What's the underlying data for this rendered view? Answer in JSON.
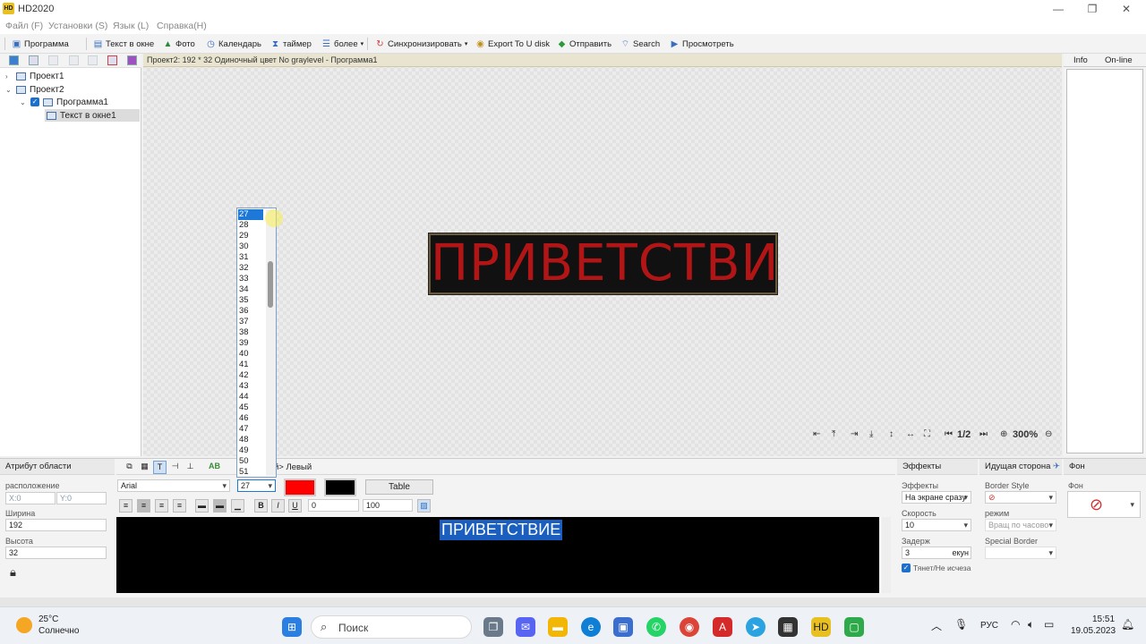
{
  "window": {
    "title": "HD2020",
    "logo": "HD"
  },
  "menu": [
    "Файл (F)",
    "Установки (S)",
    "Язык (L)",
    "Справка(H)"
  ],
  "toolbar": {
    "program": "Программа",
    "text_window": "Текст в окне",
    "photo": "Фото",
    "calendar": "Календарь",
    "timer": "таймер",
    "more": "более",
    "sync": "Синхронизировать",
    "export": "Export To U disk",
    "send": "Отправить",
    "search": "Search",
    "preview": "Просмотреть"
  },
  "tree": {
    "project1": "Проект1",
    "project2": "Проект2",
    "program1": "Программа1",
    "text1": "Текст в окне1"
  },
  "canvas": {
    "info": "Проект2: 192 * 32 Одиночный цвет No graylevel - Программа1",
    "led_text": "ПРИВЕТСТВИ",
    "page": "1/2",
    "zoom": "300%"
  },
  "right": {
    "tab_info": "Info",
    "tab_online": "On-line"
  },
  "dropdown": {
    "items": [
      "27",
      "28",
      "29",
      "30",
      "31",
      "32",
      "33",
      "34",
      "35",
      "36",
      "37",
      "38",
      "39",
      "40",
      "41",
      "42",
      "43",
      "44",
      "45",
      "46",
      "47",
      "48",
      "49",
      "50",
      "51"
    ],
    "selected": "27"
  },
  "area": {
    "header": "Атрибут области",
    "position_label": "расположение",
    "x": "X:0",
    "y": "Y:0",
    "width_label": "Ширина",
    "width": "192",
    "height_label": "Высота",
    "height": "32"
  },
  "text_editor": {
    "breadcrumb": "й> Левый",
    "font": "Arial",
    "size": "27",
    "text_color": "#ff0000",
    "bg_color": "#000000",
    "table_label": "Table",
    "spacing": "0",
    "scale": "100",
    "content": "ПРИВЕТСТВИЕ",
    "bold": "B",
    "italic": "I",
    "underline": "U"
  },
  "effects": {
    "header": "Эффекты",
    "effects_label": "Эффекты",
    "effects_value": "На экране сразу",
    "speed_label": "Скорость",
    "speed_value": "10",
    "delay_label": "Задерж",
    "delay_value": "3",
    "delay_unit": "екун",
    "stay_label": "Тянет/Не исчеза"
  },
  "border": {
    "header": "Идущая сторона",
    "style_label": "Border Style",
    "mode_label": "режим",
    "mode_value": "Вращ по часово",
    "special_label": "Special Border"
  },
  "bg": {
    "header": "Фон",
    "label": "Фон"
  },
  "taskbar": {
    "search": "Поиск",
    "weather_temp": "25°C",
    "weather_desc": "Солнечно",
    "lang": "РУС",
    "time": "15:51",
    "date": "19.05.2023"
  }
}
